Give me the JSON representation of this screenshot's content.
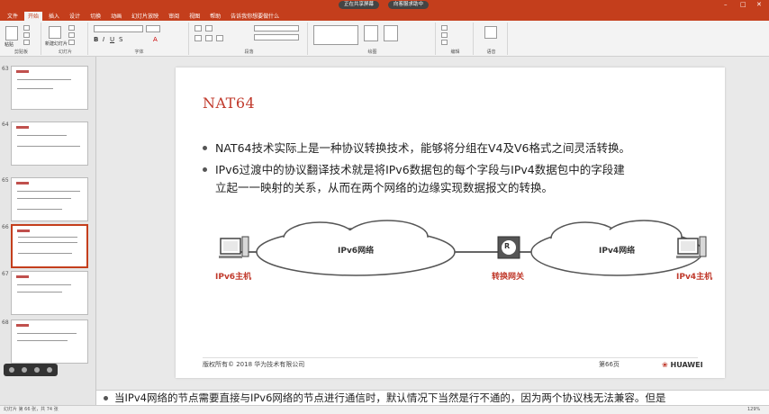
{
  "window": {
    "share_label": "正在共享屏幕",
    "meeting_label": "向客服求助中"
  },
  "tabs": [
    "文件",
    "开始",
    "插入",
    "设计",
    "切换",
    "动画",
    "幻灯片放映",
    "审阅",
    "视图",
    "帮助",
    "告诉我你想要做什么"
  ],
  "ribbon": {
    "groups": [
      "剪贴板",
      "幻灯片",
      "字体",
      "段落",
      "绘图",
      "编辑",
      "语音"
    ],
    "paste": "粘贴",
    "new_slide": "新建幻灯片",
    "start_btn": "开始"
  },
  "sidebar": {
    "slides": [
      {
        "num": "63"
      },
      {
        "num": "64"
      },
      {
        "num": "65"
      },
      {
        "num": "66"
      },
      {
        "num": "67"
      },
      {
        "num": "68"
      }
    ]
  },
  "slide": {
    "title": "NAT64",
    "bullets": [
      "NAT64技术实际上是一种协议转换技术，能够将分组在V4及V6格式之间灵活转换。",
      "IPv6过渡中的协议翻译技术就是将IPv6数据包的每个字段与IPv4数据包中的字段建",
      "立起一一映射的关系，从而在两个网络的边缘实现数据报文的转换。"
    ],
    "diagram": {
      "ipv6_cloud": "IPv6网络",
      "ipv4_cloud": "IPv4网络",
      "ipv6_host": "IPv6主机",
      "gateway": "转换网关",
      "ipv4_host": "IPv4主机",
      "gateway_symbol": "R"
    },
    "footer_copyright": "版权所有© 2018 华为技术有限公司",
    "footer_page": "第66页",
    "footer_brand": "HUAWEI"
  },
  "notes": {
    "text": "当IPv4网络的节点需要直接与IPv6网络的节点进行通信时，默认情况下当然是行不通的，因为两个协议栈无法兼容。但是"
  },
  "status": {
    "left": "幻灯片 第 66 张，共 74 张",
    "zoom": "129%"
  },
  "colors": {
    "accent": "#c43e1c",
    "title_red": "#c0392b",
    "label_red": "#c0392b"
  }
}
